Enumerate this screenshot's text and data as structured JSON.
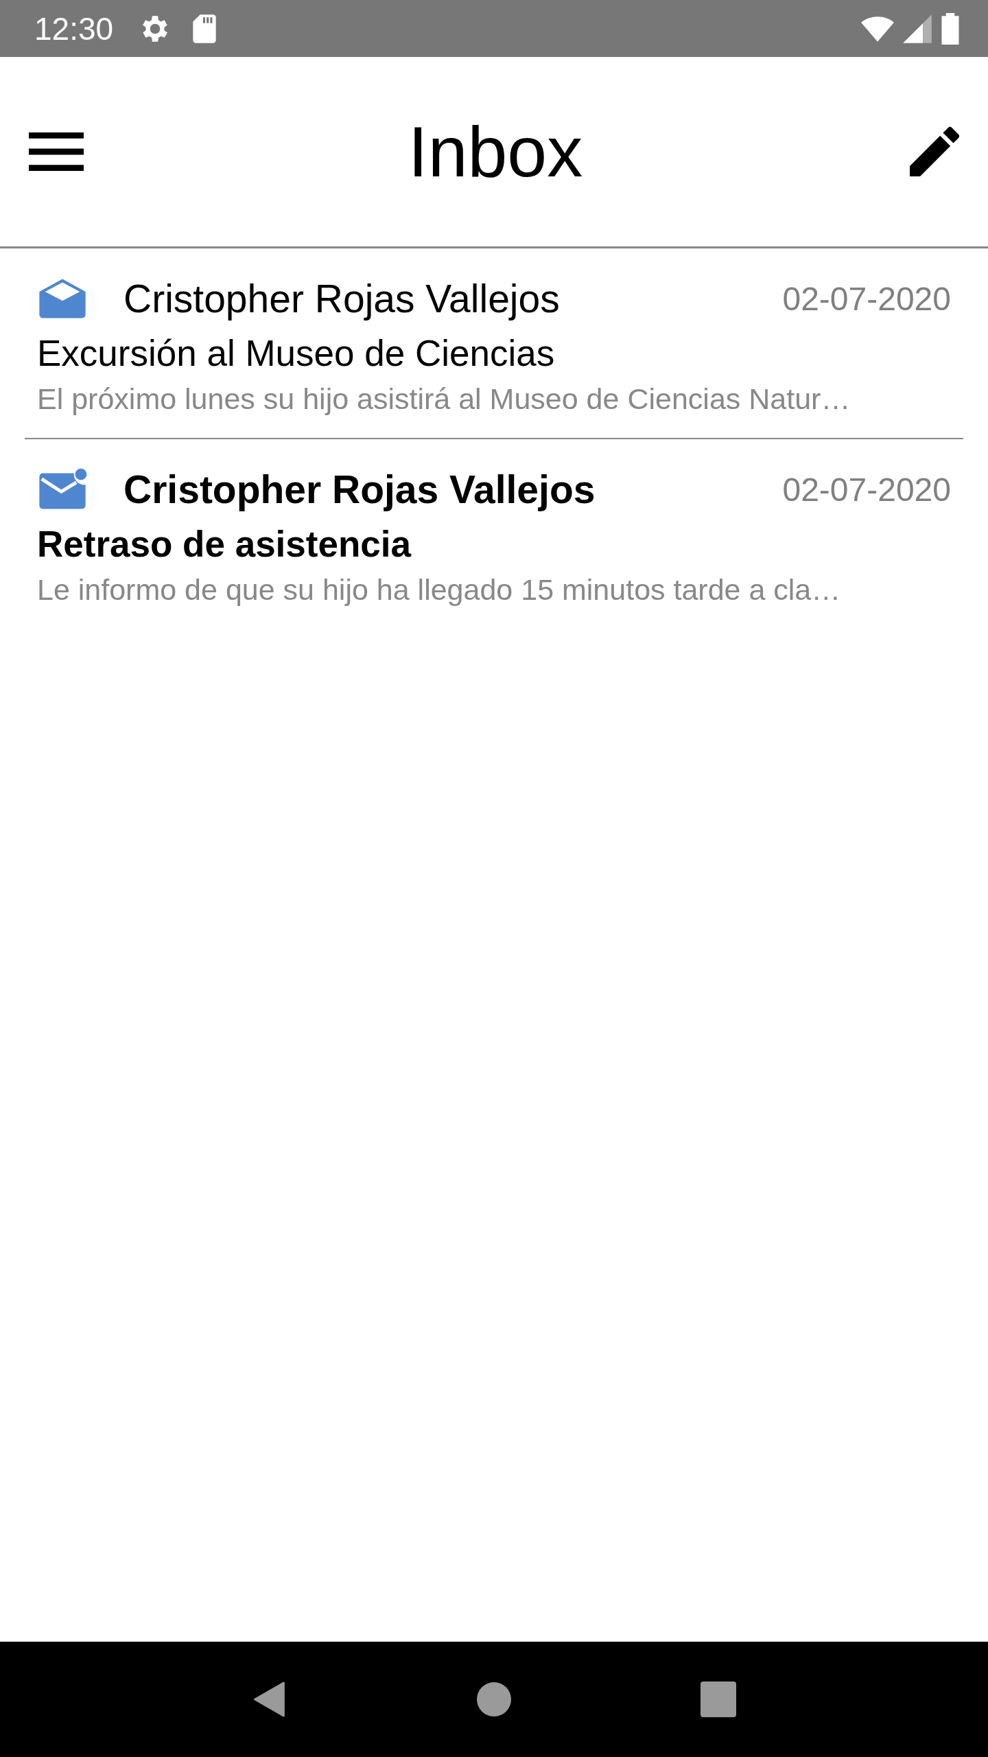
{
  "status_bar": {
    "time": "12:30"
  },
  "app_bar": {
    "title": "Inbox"
  },
  "messages": [
    {
      "sender": "Cristopher Rojas Vallejos",
      "date": "02-07-2020",
      "subject": "Excursión al Museo de Ciencias",
      "preview": "El próximo lunes su hijo asistirá al Museo de Ciencias Natur…",
      "read": true
    },
    {
      "sender": "Cristopher Rojas Vallejos",
      "date": "02-07-2020",
      "subject": "Retraso de asistencia",
      "preview": "Le informo de que su hijo ha llegado 15 minutos tarde a cla…",
      "read": false
    }
  ]
}
